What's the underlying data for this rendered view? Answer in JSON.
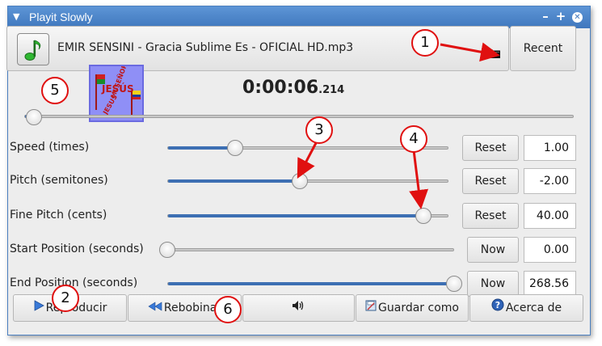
{
  "window": {
    "title": "Playit Slowly"
  },
  "file": {
    "name": "EMIR SENSINI - Gracia Sublime Es - OFICIAL HD.mp3",
    "recent_label": "Recent"
  },
  "time": {
    "main": "0:00:06",
    "ms": ".214"
  },
  "album_art": {
    "text_top": "JESÚS",
    "text_side": "MI SEÑOR",
    "text_diag": "JESUS"
  },
  "rows": [
    {
      "label": "Speed (times)",
      "button": "Reset",
      "value": "1.00",
      "level": 0.24
    },
    {
      "label": "Pitch (semitones)",
      "button": "Reset",
      "value": "-2.00",
      "level": 0.47
    },
    {
      "label": "Fine Pitch (cents)",
      "button": "Reset",
      "value": "40.00",
      "level": 0.91
    },
    {
      "label": "Start Position (seconds)",
      "button": "Now",
      "value": "0.00",
      "level": 0.0
    },
    {
      "label": "End Position (seconds)",
      "button": "Now",
      "value": "268.56",
      "level": 1.0
    }
  ],
  "seek_level": 0.0,
  "bottom": {
    "play": "Reproducir",
    "rewind": "Rebobinar",
    "save": "Guardar como",
    "about": "Acerca de"
  },
  "annotations": [
    "1",
    "2",
    "3",
    "4",
    "5",
    "6"
  ],
  "colors": {
    "title_bar": "#4a82c8",
    "slider_fill": "#3d6fb3",
    "annotation": "#e01010"
  }
}
